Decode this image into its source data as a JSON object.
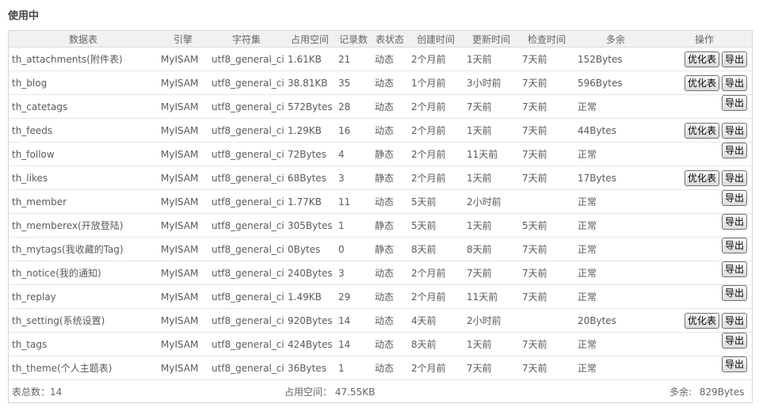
{
  "section_title": "使用中",
  "headers": {
    "name": "数据表",
    "engine": "引擎",
    "charset": "字符集",
    "size": "占用空间",
    "rows": "记录数",
    "status": "表状态",
    "created": "创建时间",
    "updated": "更新时间",
    "checked": "检查时间",
    "overhead": "多余",
    "actions": "操作"
  },
  "buttons": {
    "optimize": "优化表",
    "export": "导出"
  },
  "rows": [
    {
      "name": "th_attachments(附件表)",
      "engine": "MyISAM",
      "charset": "utf8_general_ci",
      "size": "1.61KB",
      "rows": "21",
      "status": "动态",
      "created": "2个月前",
      "updated": "1天前",
      "checked": "7天前",
      "overhead": "152Bytes",
      "optimize": true
    },
    {
      "name": "th_blog",
      "engine": "MyISAM",
      "charset": "utf8_general_ci",
      "size": "38.81KB",
      "rows": "35",
      "status": "动态",
      "created": "1个月前",
      "updated": "3小时前",
      "checked": "7天前",
      "overhead": "596Bytes",
      "optimize": true
    },
    {
      "name": "th_catetags",
      "engine": "MyISAM",
      "charset": "utf8_general_ci",
      "size": "572Bytes",
      "rows": "28",
      "status": "动态",
      "created": "2个月前",
      "updated": "7天前",
      "checked": "7天前",
      "overhead": "正常",
      "optimize": false
    },
    {
      "name": "th_feeds",
      "engine": "MyISAM",
      "charset": "utf8_general_ci",
      "size": "1.29KB",
      "rows": "16",
      "status": "动态",
      "created": "2个月前",
      "updated": "1天前",
      "checked": "7天前",
      "overhead": "44Bytes",
      "optimize": true
    },
    {
      "name": "th_follow",
      "engine": "MyISAM",
      "charset": "utf8_general_ci",
      "size": "72Bytes",
      "rows": "4",
      "status": "静态",
      "created": "2个月前",
      "updated": "11天前",
      "checked": "7天前",
      "overhead": "正常",
      "optimize": false
    },
    {
      "name": "th_likes",
      "engine": "MyISAM",
      "charset": "utf8_general_ci",
      "size": "68Bytes",
      "rows": "3",
      "status": "静态",
      "created": "2个月前",
      "updated": "1天前",
      "checked": "7天前",
      "overhead": "17Bytes",
      "optimize": true
    },
    {
      "name": "th_member",
      "engine": "MyISAM",
      "charset": "utf8_general_ci",
      "size": "1.77KB",
      "rows": "11",
      "status": "动态",
      "created": "5天前",
      "updated": "2小时前",
      "checked": "",
      "overhead": "正常",
      "optimize": false
    },
    {
      "name": "th_memberex(开放登陆)",
      "engine": "MyISAM",
      "charset": "utf8_general_ci",
      "size": "305Bytes",
      "rows": "1",
      "status": "静态",
      "created": "5天前",
      "updated": "1天前",
      "checked": "5天前",
      "overhead": "正常",
      "optimize": false
    },
    {
      "name": "th_mytags(我收藏的Tag)",
      "engine": "MyISAM",
      "charset": "utf8_general_ci",
      "size": "0Bytes",
      "rows": "0",
      "status": "静态",
      "created": "8天前",
      "updated": "8天前",
      "checked": "7天前",
      "overhead": "正常",
      "optimize": false
    },
    {
      "name": "th_notice(我的通知)",
      "engine": "MyISAM",
      "charset": "utf8_general_ci",
      "size": "240Bytes",
      "rows": "3",
      "status": "动态",
      "created": "2个月前",
      "updated": "7天前",
      "checked": "7天前",
      "overhead": "正常",
      "optimize": false
    },
    {
      "name": "th_replay",
      "engine": "MyISAM",
      "charset": "utf8_general_ci",
      "size": "1.49KB",
      "rows": "29",
      "status": "动态",
      "created": "2个月前",
      "updated": "11天前",
      "checked": "7天前",
      "overhead": "正常",
      "optimize": false
    },
    {
      "name": "th_setting(系统设置)",
      "engine": "MyISAM",
      "charset": "utf8_general_ci",
      "size": "920Bytes",
      "rows": "14",
      "status": "动态",
      "created": "4天前",
      "updated": "2小时前",
      "checked": "",
      "overhead": "20Bytes",
      "optimize": true
    },
    {
      "name": "th_tags",
      "engine": "MyISAM",
      "charset": "utf8_general_ci",
      "size": "424Bytes",
      "rows": "14",
      "status": "动态",
      "created": "8天前",
      "updated": "1天前",
      "checked": "7天前",
      "overhead": "正常",
      "optimize": false
    },
    {
      "name": "th_theme(个人主题表)",
      "engine": "MyISAM",
      "charset": "utf8_general_ci",
      "size": "36Bytes",
      "rows": "1",
      "status": "动态",
      "created": "2个月前",
      "updated": "7天前",
      "checked": "7天前",
      "overhead": "正常",
      "optimize": false
    }
  ],
  "footer": {
    "total_label": "表总数：14",
    "space_label": "占用空间：",
    "space_value": "47.55KB",
    "overhead_label": "多余:",
    "overhead_value": "829Bytes"
  }
}
